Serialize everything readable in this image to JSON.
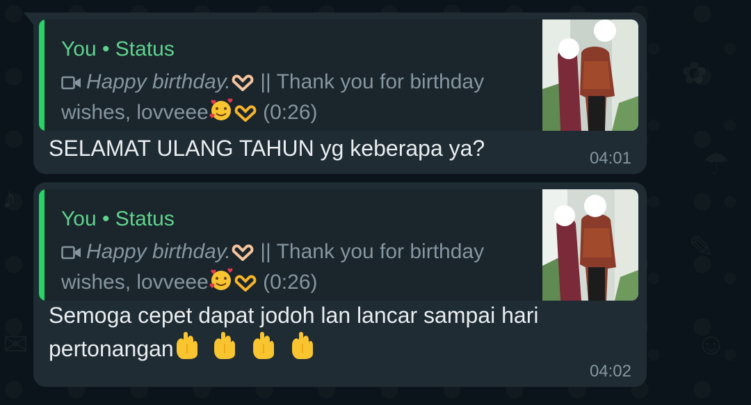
{
  "messages": [
    {
      "quoted": {
        "sender": "You • Status",
        "caption_italic": "Happy birthday.",
        "caption_rest": " || Thank you for birthday wishes, lovveee",
        "duration": "(0:26)",
        "media_icon": "video-icon"
      },
      "text": "SELAMAT ULANG TAHUN yg keberapa ya?",
      "time": "04:01"
    },
    {
      "quoted": {
        "sender": "You • Status",
        "caption_italic": "Happy birthday.",
        "caption_rest": " || Thank you for birthday wishes, lovveee",
        "duration": "(0:26)",
        "media_icon": "video-icon"
      },
      "text": "Semoga cepet dapat jodoh lan lancar sampai hari pertonangan",
      "time": "04:02"
    }
  ],
  "colors": {
    "background": "#0b141a",
    "bubble": "#1f2c34",
    "quote_bar": "#25d366",
    "quote_sender": "#5fd38d",
    "secondary_text": "#8696a0",
    "primary_text": "#e9edef"
  }
}
